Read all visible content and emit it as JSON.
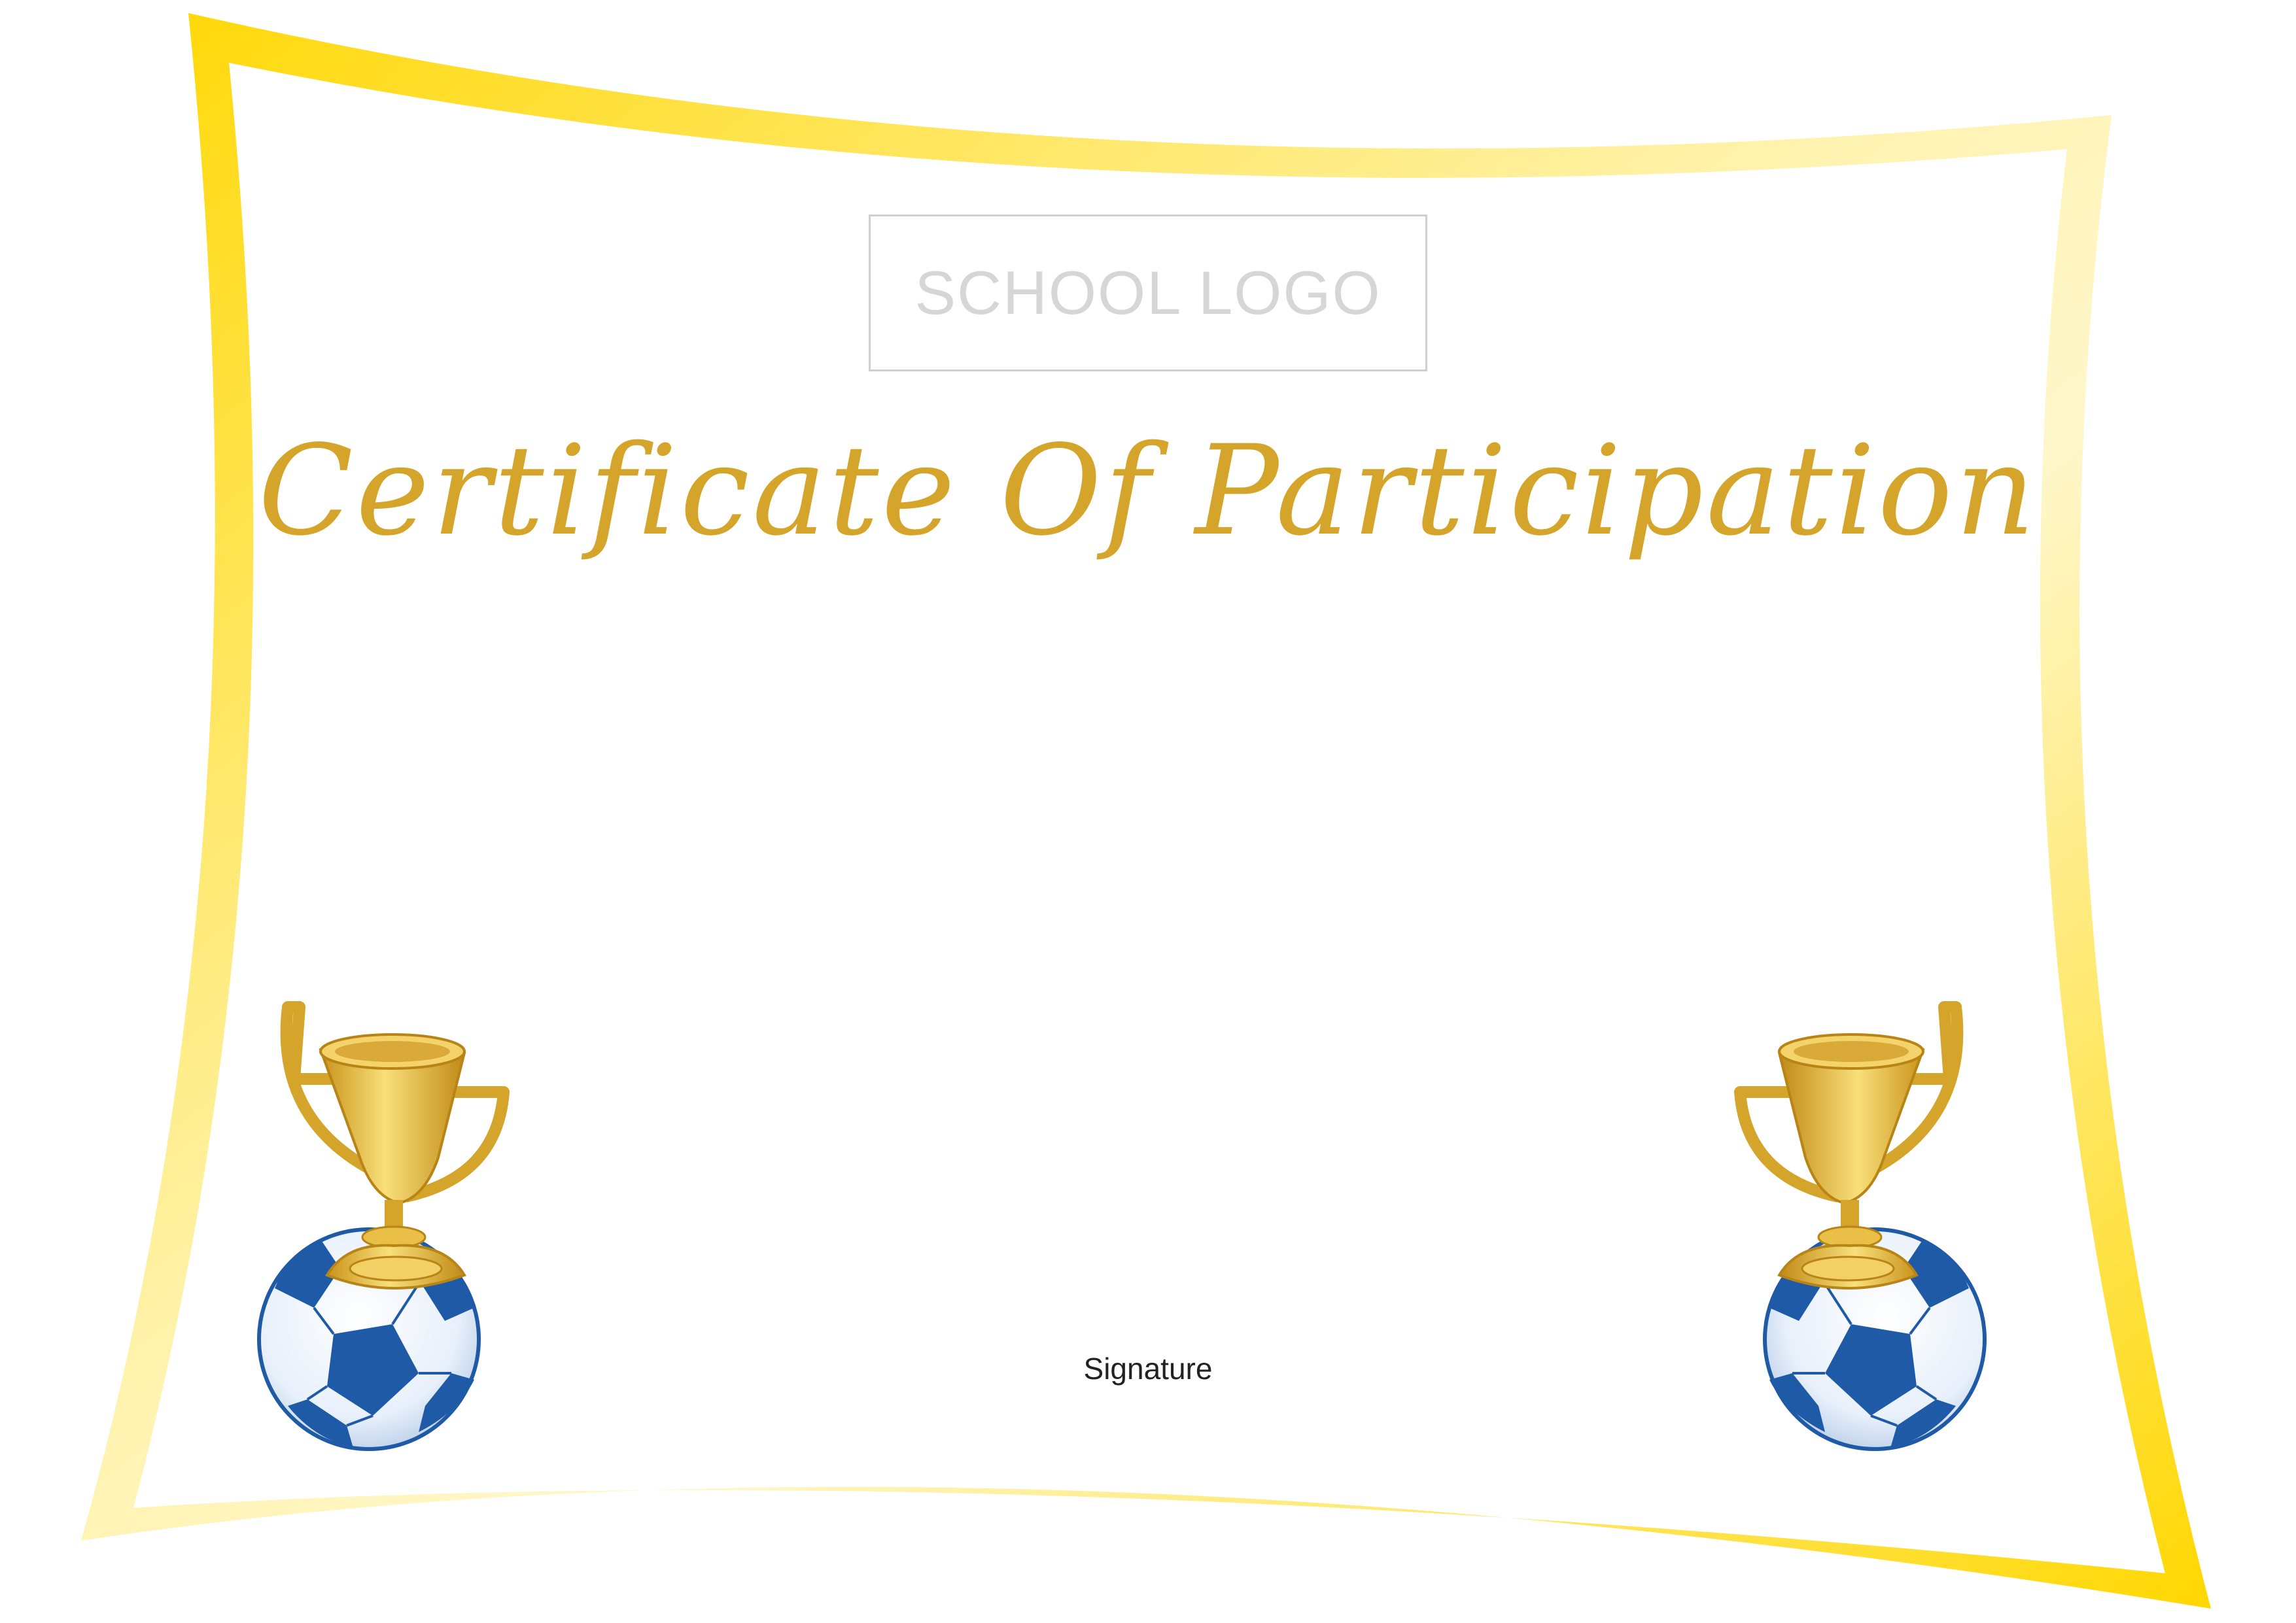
{
  "logo_placeholder": "SCHOOL LOGO",
  "title": "Certificate Of Participation",
  "signature_label": "Signature",
  "colors": {
    "frame_gold": "#ffd700",
    "frame_light": "#fff6c2",
    "title_gold": "#d4a52a",
    "trophy_gold": "#e6b830",
    "ball_blue": "#1f5aa6"
  },
  "icons": {
    "left_decoration": "trophy-on-soccer-ball-icon",
    "right_decoration": "trophy-on-soccer-ball-icon"
  }
}
